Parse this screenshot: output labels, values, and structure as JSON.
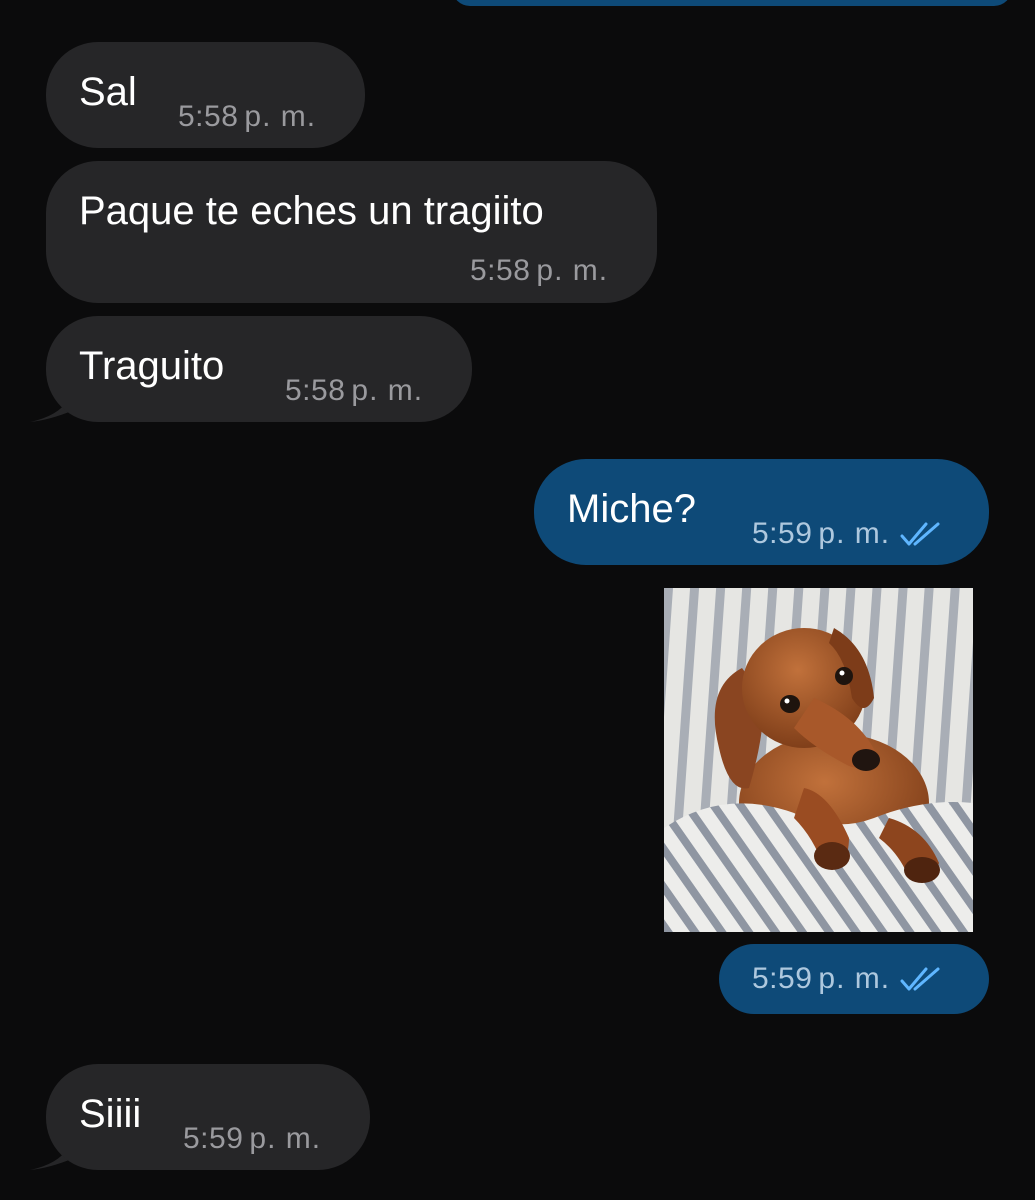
{
  "messages": [
    {
      "id": "m1",
      "direction": "incoming",
      "text": "Sal",
      "time": "5:58",
      "ampm": "p. m."
    },
    {
      "id": "m2",
      "direction": "incoming",
      "text": "Paque te eches un tragiito",
      "time": "5:58",
      "ampm": "p. m."
    },
    {
      "id": "m3",
      "direction": "incoming",
      "text": "Traguito",
      "time": "5:58",
      "ampm": "p. m."
    },
    {
      "id": "m4",
      "direction": "outgoing",
      "text": "Miche?",
      "time": "5:59",
      "ampm": "p. m.",
      "status_icon": "double-check-icon"
    },
    {
      "id": "m5",
      "direction": "outgoing",
      "image": "dachshund-photo",
      "time": "5:59",
      "ampm": "p. m.",
      "status_icon": "double-check-icon"
    },
    {
      "id": "m6",
      "direction": "incoming",
      "text": "Siiii",
      "time": "5:59",
      "ampm": "p. m."
    }
  ],
  "colors": {
    "background": "#0b0b0c",
    "incoming_bubble": "#262628",
    "outgoing_bubble": "#0e4a78",
    "incoming_meta": "#9a9a9e",
    "outgoing_meta": "#aec8de",
    "check_mark": "#5fb6ff"
  }
}
